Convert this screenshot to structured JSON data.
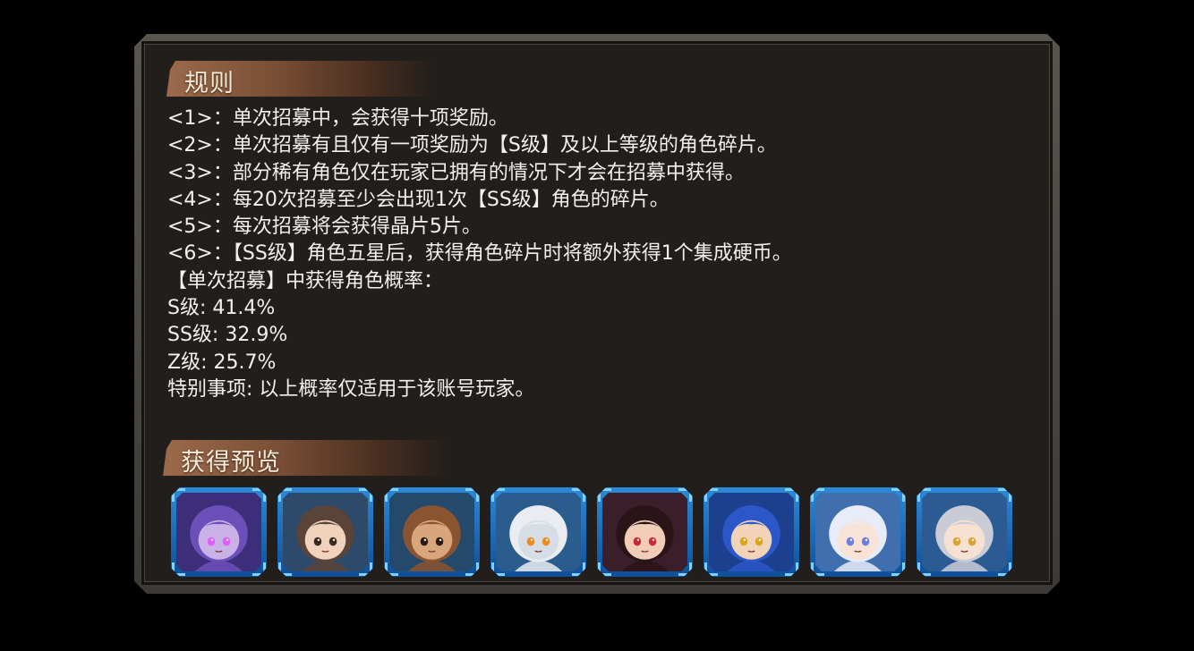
{
  "rules_section": {
    "title": "规则",
    "lines": [
      "<1>：单次招募中，会获得十项奖励。",
      "<2>：单次招募有且仅有一项奖励为【S级】及以上等级的角色碎片。",
      "<3>：部分稀有角色仅在玩家已拥有的情况下才会在招募中获得。",
      "<4>：每20次招募至少会出现1次【SS级】角色的碎片。",
      "<5>：每次招募将会获得晶片5片。",
      "<6>：【SS级】角色五星后，获得角色碎片时将额外获得1个集成硬币。",
      "【单次招募】中获得角色概率：",
      "S级: 41.4%",
      "SS级: 32.9%",
      "Z级: 25.7%",
      "特别事项: 以上概率仅适用于该账号玩家。"
    ]
  },
  "preview_section": {
    "title": "获得预览",
    "portraits": [
      {
        "name": "portrait-purple-hooded",
        "bg": "#3d2e7a",
        "hair": "#6c4fb8",
        "skin": "#c9b3e6",
        "eye": "#e05cff"
      },
      {
        "name": "portrait-brown-hair-girl",
        "bg": "#2d4a6a",
        "hair": "#5a4338",
        "skin": "#f0d2bd",
        "eye": "#3a2a20"
      },
      {
        "name": "portrait-brown-spiky-man",
        "bg": "#24496b",
        "hair": "#8a5430",
        "skin": "#d9a67c",
        "eye": "#2a1a10"
      },
      {
        "name": "portrait-white-mecha",
        "bg": "#2a5d8e",
        "hair": "#e9edf2",
        "skin": "#d7dde4",
        "eye": "#f08a1c"
      },
      {
        "name": "portrait-eyepatch-girl",
        "bg": "#3a1e2a",
        "hair": "#2a1418",
        "skin": "#f1cdb8",
        "eye": "#c7283a"
      },
      {
        "name": "portrait-blue-hair-man",
        "bg": "#1c3f8e",
        "hair": "#2b57c9",
        "skin": "#f2d3b8",
        "eye": "#d8a71e"
      },
      {
        "name": "portrait-white-hair-girl",
        "bg": "#3f6fae",
        "hair": "#e7ecf8",
        "skin": "#f8e3d6",
        "eye": "#6f7fe0"
      },
      {
        "name": "portrait-silver-cat-girl",
        "bg": "#2c5b94",
        "hair": "#c9ccd6",
        "skin": "#f6e1d2",
        "eye": "#d9a432"
      }
    ]
  }
}
